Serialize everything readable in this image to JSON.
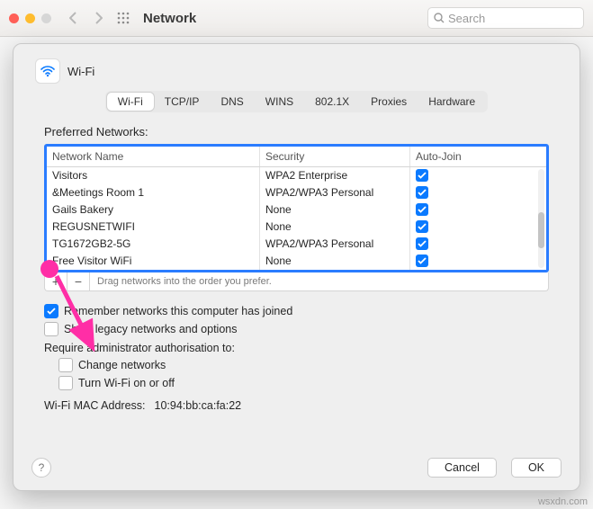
{
  "window": {
    "title": "Network",
    "search_placeholder": "Search"
  },
  "pane": {
    "title": "Wi-Fi"
  },
  "tabs": [
    "Wi-Fi",
    "TCP/IP",
    "DNS",
    "WINS",
    "802.1X",
    "Proxies",
    "Hardware"
  ],
  "table": {
    "heading": "Preferred Networks:",
    "columns": [
      "Network Name",
      "Security",
      "Auto-Join"
    ],
    "drag_hint": "Drag networks into the order you prefer.",
    "rows": [
      {
        "name": "Visitors",
        "security": "WPA2 Enterprise",
        "autojoin": true
      },
      {
        "name": "&Meetings Room 1",
        "security": "WPA2/WPA3 Personal",
        "autojoin": true
      },
      {
        "name": "Gails Bakery",
        "security": "None",
        "autojoin": true
      },
      {
        "name": "REGUSNETWIFI",
        "security": "None",
        "autojoin": true
      },
      {
        "name": "TG1672GB2-5G",
        "security": "WPA2/WPA3 Personal",
        "autojoin": true
      },
      {
        "name": "Free Visitor WiFi",
        "security": "None",
        "autojoin": true
      }
    ]
  },
  "options": {
    "remember": "Remember networks this computer has joined",
    "legacy": "Show legacy networks and options",
    "require_admin": "Require administrator authorisation to:",
    "change_networks": "Change networks",
    "turn_wifi": "Turn Wi-Fi on or off"
  },
  "mac": {
    "label": "Wi-Fi MAC Address:",
    "value": "10:94:bb:ca:fa:22"
  },
  "buttons": {
    "cancel": "Cancel",
    "ok": "OK"
  },
  "watermark": "wsxdn.com"
}
